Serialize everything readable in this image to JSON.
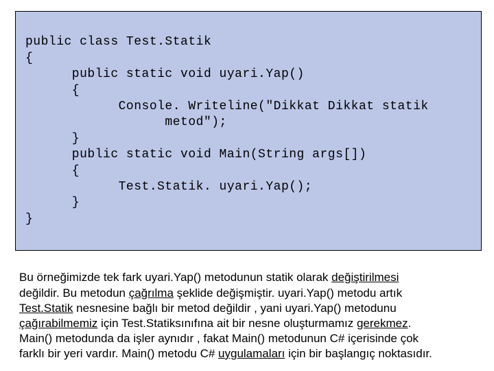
{
  "code": {
    "l1": "public class Test.Statik",
    "l2": "{",
    "l3": "      public static void uyari.Yap()",
    "l4": "      {",
    "l5": "            Console. Writeline(\"Dikkat Dikkat statik",
    "l6": "                  metod\");",
    "l7": "      }",
    "l8": "      public static void Main(String args[])",
    "l9": "      {",
    "l10": "            Test.Statik. uyari.Yap();",
    "l11": "      }",
    "l12": "}"
  },
  "para": {
    "s1a": "Bu örneğimizde tek fark uyari.Yap() metodunun statik olarak ",
    "s1b": "değiştirilmesi",
    "s2a": "değildir. Bu metodun ",
    "s2b": "çağrılma",
    "s2c": " şeklide değişmiştir. uyari.Yap() metodu artık ",
    "s3a": "Test.",
    "s3b": "Statik",
    "s3c": " nesnesine bağlı bir metod değildir , yani uyari.Yap() metodunu ",
    "s4a": "çağırabilmemiz",
    "s4b": " için Test.Statiksınıfına ait bir nesne oluşturmamız ",
    "s4c": "gerekmez",
    "s4d": ". ",
    "s5a": "Main() metodunda da işler aynıdır , fakat Main() metodunun C# içerisinde çok ",
    "s6a": "farklı bir yeri vardır. Main() metodu C# ",
    "s6b": "uygulamaları",
    "s6c": " için bir başlangıç noktasıdır."
  }
}
